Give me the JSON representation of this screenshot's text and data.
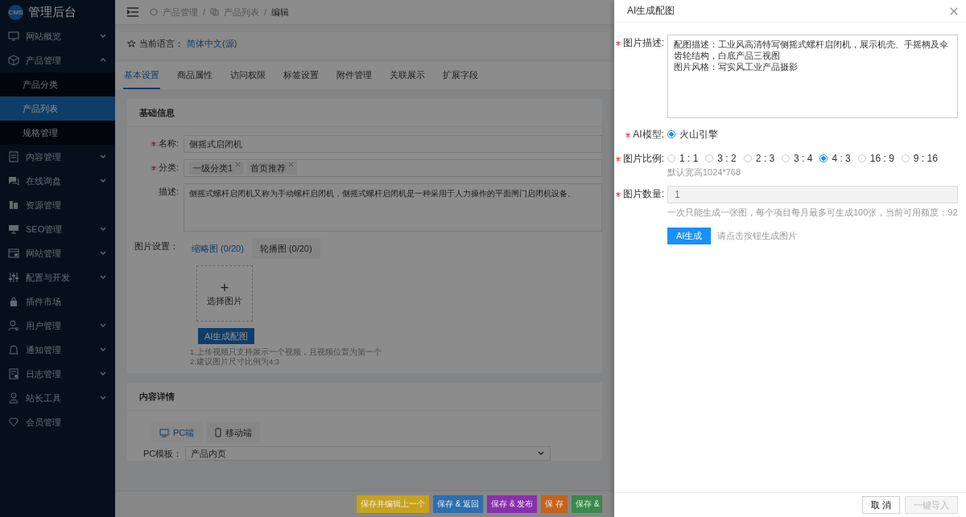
{
  "sidebar": {
    "logo_badge": "CMS",
    "title": "管理后台",
    "items": [
      {
        "label": "网站概览",
        "kind": "group",
        "expanded": false
      },
      {
        "label": "产品管理",
        "kind": "group",
        "expanded": true,
        "children": [
          {
            "label": "产品分类",
            "selected": false
          },
          {
            "label": "产品列表",
            "selected": true
          },
          {
            "label": "规格管理",
            "selected": false
          }
        ]
      },
      {
        "label": "内容管理",
        "kind": "group",
        "expanded": false
      },
      {
        "label": "在线询盘",
        "kind": "group",
        "expanded": false
      },
      {
        "label": "资源管理",
        "kind": "link"
      },
      {
        "label": "SEO管理",
        "kind": "group",
        "expanded": false
      },
      {
        "label": "网站管理",
        "kind": "group",
        "expanded": false
      },
      {
        "label": "配置与开发",
        "kind": "group",
        "expanded": false
      },
      {
        "label": "插件市场",
        "kind": "link"
      },
      {
        "label": "用户管理",
        "kind": "group",
        "expanded": false
      },
      {
        "label": "通知管理",
        "kind": "group",
        "expanded": false
      },
      {
        "label": "日志管理",
        "kind": "group",
        "expanded": false
      },
      {
        "label": "站长工具",
        "kind": "group",
        "expanded": false
      },
      {
        "label": "会员管理",
        "kind": "link"
      }
    ]
  },
  "breadcrumb": {
    "separator": "/",
    "items": [
      "产品管理",
      "产品列表",
      "编辑"
    ]
  },
  "language": {
    "label": "当前语言：",
    "value": "简体中文(源)"
  },
  "tabs": [
    {
      "label": "基本设置",
      "selected": true
    },
    {
      "label": "商品属性",
      "selected": false
    },
    {
      "label": "访问权限",
      "selected": false
    },
    {
      "label": "标签设置",
      "selected": false
    },
    {
      "label": "附件管理",
      "selected": false
    },
    {
      "label": "关联展示",
      "selected": false
    },
    {
      "label": "扩展字段",
      "selected": false
    }
  ],
  "basic_info": {
    "title": "基础信息",
    "name": {
      "label": "名称:",
      "required": true,
      "value": "侧摇式启闭机"
    },
    "category": {
      "label": "分类:",
      "required": true,
      "tags": [
        "一级分类1",
        "首页推荐"
      ]
    },
    "description": {
      "label": "描述:",
      "required": false,
      "value": "侧摇式螺杆启闭机又称为手动螺杆启闭机，侧摇式螺杆启闭机是一种采用于人力操作的平面闸门启闭机设备。"
    },
    "images": {
      "label": "图片设置：",
      "tabs": [
        {
          "label": "缩略图 (0/20)",
          "selected": true
        },
        {
          "label": "轮播图 (0/20)",
          "selected": false
        }
      ],
      "upload_plus": "+",
      "upload_label": "选择图片",
      "ai_button": "AI生成配图",
      "notes": [
        "1.上传视频只支持展示一个视频，且视频位置为第一个",
        "2.建议图片尺寸比例为4:3"
      ]
    }
  },
  "content_detail": {
    "title": "内容详情",
    "devices": [
      {
        "label": "PC端",
        "selected": true
      },
      {
        "label": "移动端",
        "selected": false
      }
    ],
    "template": {
      "label": "PC模板：",
      "value": "产品内页"
    }
  },
  "actions": [
    {
      "label": "保存并编辑上一个",
      "color": "#c9a21c"
    },
    {
      "label": "保存 & 返回",
      "color": "#2a6fb0"
    },
    {
      "label": "保存 & 发布",
      "color": "#8a2fb0"
    },
    {
      "label": "保 存",
      "color": "#c8621a"
    },
    {
      "label": "保存 &",
      "color": "#3a8a48"
    }
  ],
  "drawer": {
    "title": "AI生成配图",
    "description": {
      "label": "图片描述:",
      "required": true,
      "lines": [
        "配图描述：工业风高清特写侧摇式螺杆启闭机，展示机壳、手摇柄及伞齿轮结构，白底产品三视图",
        "图片风格：写实风工业产品摄影"
      ]
    },
    "model": {
      "label": "AI模型:",
      "required": true,
      "options": [
        {
          "label": "火山引擎",
          "selected": true
        }
      ]
    },
    "ratio": {
      "label": "图片比例:",
      "required": true,
      "options": [
        {
          "label": "1 : 1",
          "selected": false
        },
        {
          "label": "3 : 2",
          "selected": false
        },
        {
          "label": "2 : 3",
          "selected": false
        },
        {
          "label": "3 : 4",
          "selected": false
        },
        {
          "label": "4 : 3",
          "selected": true
        },
        {
          "label": "16 : 9",
          "selected": false
        },
        {
          "label": "9 : 16",
          "selected": false
        }
      ],
      "hint": "默认宽高1024*768"
    },
    "quantity": {
      "label": "图片数量:",
      "required": true,
      "value": "1",
      "disabled": true,
      "hint": "一次只能生成一张图，每个项目每月最多可生成100张，当前可用额度：92"
    },
    "generate": {
      "button": "AI生成",
      "hint": "请点击按钮生成图片"
    },
    "footer": [
      {
        "label": "取 消",
        "disabled": false
      },
      {
        "label": "一键导入",
        "disabled": true
      }
    ]
  }
}
